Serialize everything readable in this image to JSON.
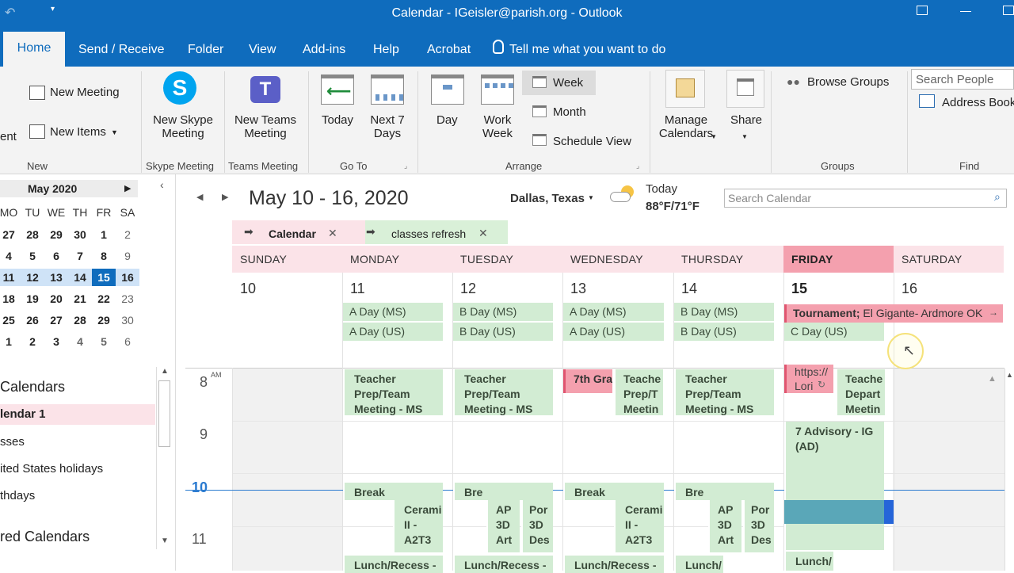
{
  "window": {
    "title": "Calendar - IGeisler@parish.org  -  Outlook"
  },
  "tabs": [
    "Home",
    "Send / Receive",
    "Folder",
    "View",
    "Add-ins",
    "Help",
    "Acrobat",
    "Tell me what you want to do"
  ],
  "ribbon": {
    "new_meeting": "New Meeting",
    "new_items": "New Items",
    "ent": "ent",
    "group_new": "New",
    "skype_l1": "New Skype",
    "skype_l2": "Meeting",
    "group_skype": "Skype Meeting",
    "teams_l1": "New Teams",
    "teams_l2": "Meeting",
    "group_teams": "Teams Meeting",
    "today": "Today",
    "next7_l1": "Next 7",
    "next7_l2": "Days",
    "group_goto": "Go To",
    "day": "Day",
    "workweek_l1": "Work",
    "workweek_l2": "Week",
    "week": "Week",
    "month": "Month",
    "schedule": "Schedule View",
    "group_arrange": "Arrange",
    "manage_l1": "Manage",
    "manage_l2": "Calendars",
    "share": "Share",
    "browse_groups": "Browse Groups",
    "group_groups": "Groups",
    "search_people": "Search People",
    "address_book": "Address Book",
    "group_find": "Find"
  },
  "mini_cal": {
    "title": "May 2020",
    "dow": [
      "MO",
      "TU",
      "WE",
      "TH",
      "FR",
      "SA"
    ],
    "weeks": [
      [
        "27",
        "28",
        "29",
        "30",
        "1",
        "2"
      ],
      [
        "4",
        "5",
        "6",
        "7",
        "8",
        "9"
      ],
      [
        "11",
        "12",
        "13",
        "14",
        "15",
        "16"
      ],
      [
        "18",
        "19",
        "20",
        "21",
        "22",
        "23"
      ],
      [
        "25",
        "26",
        "27",
        "28",
        "29",
        "30"
      ],
      [
        "1",
        "2",
        "3",
        "4",
        "5",
        "6"
      ]
    ]
  },
  "nav": {
    "my_calendars": "Calendars",
    "calendar1": "lendar 1",
    "classes": "sses",
    "us_holidays": "ited States holidays",
    "birthdays": "thdays",
    "shared": "red Calendars"
  },
  "header": {
    "range": "May 10 - 16, 2020",
    "location": "Dallas, Texas",
    "weather_label": "Today",
    "weather_temp": "88°F/71°F",
    "search_placeholder": "Search Calendar"
  },
  "cal_tabs": {
    "calendar": "Calendar",
    "classes": "classes refresh"
  },
  "days": [
    {
      "name": "SUNDAY",
      "num": "10"
    },
    {
      "name": "MONDAY",
      "num": "11"
    },
    {
      "name": "TUESDAY",
      "num": "12"
    },
    {
      "name": "WEDNESDAY",
      "num": "13"
    },
    {
      "name": "THURSDAY",
      "num": "14"
    },
    {
      "name": "FRIDAY",
      "num": "15"
    },
    {
      "name": "SATURDAY",
      "num": "16"
    }
  ],
  "allday": {
    "a_ms": "A Day (MS)",
    "a_us": "A Day (US)",
    "b_ms": "B Day (MS)",
    "b_us": "B Day (US)",
    "c_us": "C Day (US)",
    "tournament_bold": "Tournament;",
    "tournament_rest": " El Gigante- Ardmore OK"
  },
  "hours": {
    "h8": "8",
    "am": "AM",
    "h9": "9",
    "h10": "10",
    "h11": "11"
  },
  "events": {
    "teacher_prep": "Teacher Prep/Team Meeting - MS",
    "seventh": "7th Gra",
    "teacher_prep_narrow": "Teache Prep/T Meetin",
    "https": "https:// Lori",
    "teacher_dept": "Teache Depart Meetin",
    "advisory": "7 Advisory - IG (AD)",
    "break": "Break",
    "bre": "Bre",
    "ceramics": "Cerami II - A2T3",
    "ap3d": "AP 3D Art",
    "por3d": "Por 3D Des",
    "lunch": "Lunch/Recess -",
    "lunch_short": "Lunch/"
  },
  "colors": {
    "accent": "#0f6cbd",
    "event_green": "#d2ecd3",
    "today_header": "#f4a0ae",
    "day_header": "#fbe3e8",
    "tournament": "#f4a0ae"
  }
}
